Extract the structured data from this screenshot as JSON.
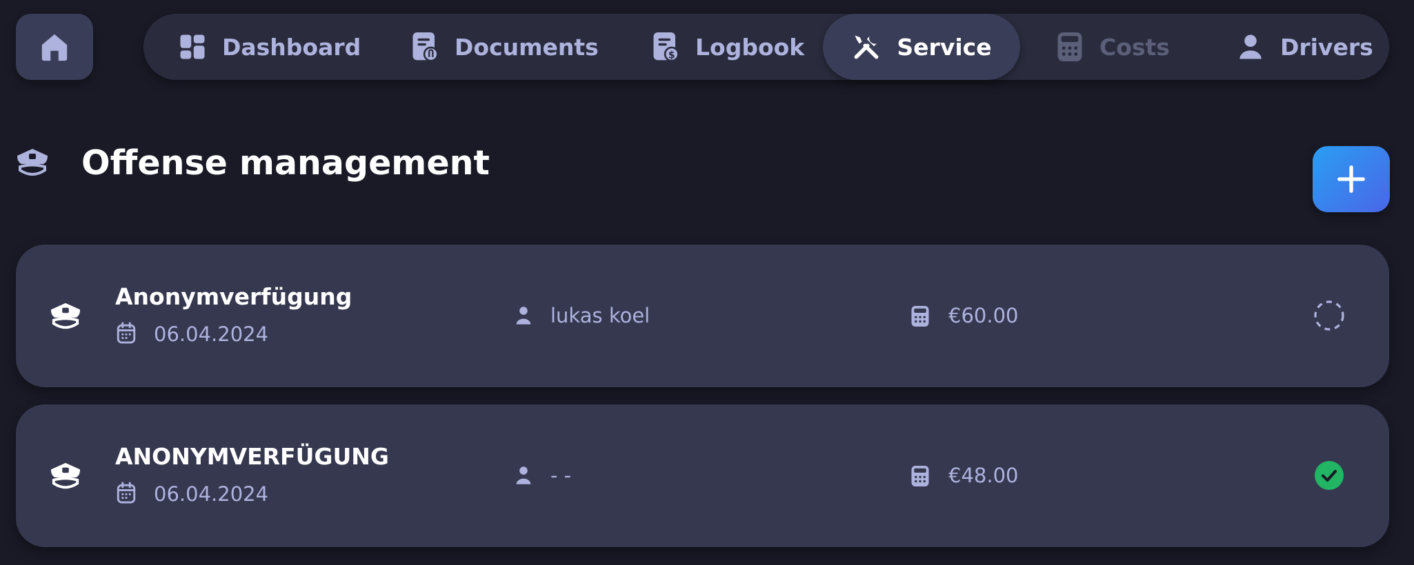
{
  "nav": {
    "items": [
      {
        "label": "Dashboard",
        "icon": "dashboard-icon",
        "state": "normal"
      },
      {
        "label": "Documents",
        "icon": "document-attachment-icon",
        "state": "normal"
      },
      {
        "label": "Logbook",
        "icon": "logbook-icon",
        "state": "normal"
      },
      {
        "label": "Service",
        "icon": "tools-icon",
        "state": "active"
      },
      {
        "label": "Costs",
        "icon": "calculator-icon",
        "state": "disabled"
      },
      {
        "label": "Drivers",
        "icon": "person-icon",
        "state": "normal"
      }
    ]
  },
  "page": {
    "title": "Offense management",
    "icon": "police-cap-icon"
  },
  "offenses": [
    {
      "title": "Anonymverfügung",
      "date": "06.04.2024",
      "driver": "lukas koel",
      "cost": "€60.00",
      "status": "pending"
    },
    {
      "title": "ANONYMVERFÜGUNG",
      "date": "06.04.2024",
      "driver": "- -",
      "cost": "€48.00",
      "status": "paid"
    }
  ],
  "colors": {
    "background": "#191a26",
    "surface": "#363850",
    "accent_start": "#2a9ef2",
    "accent_end": "#4a66e8",
    "text_muted": "#aeb3de",
    "status_paid": "#22b564"
  }
}
